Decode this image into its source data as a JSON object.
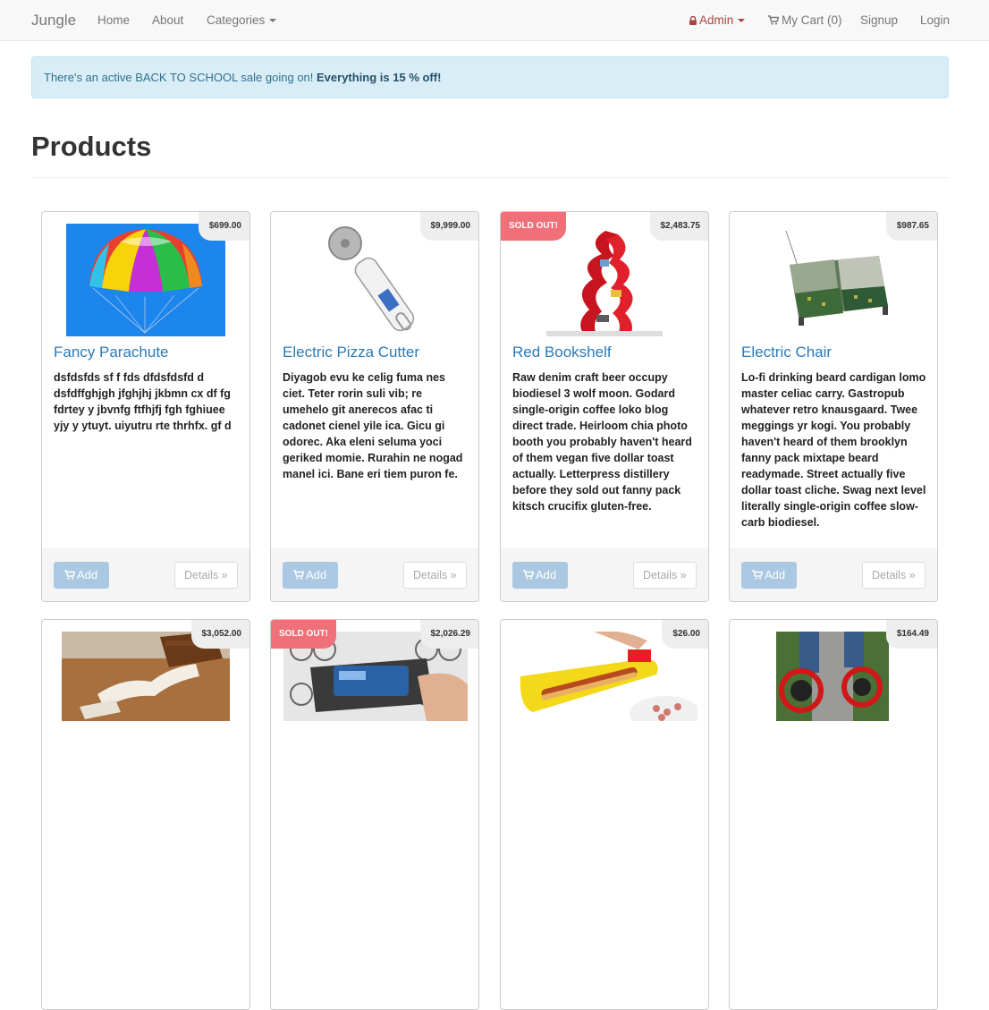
{
  "navbar": {
    "brand": "Jungle",
    "home": "Home",
    "about": "About",
    "categories": "Categories",
    "admin": "Admin",
    "cart": "My Cart (0)",
    "signup": "Signup",
    "login": "Login"
  },
  "alert": {
    "text": "There's an active BACK TO SCHOOL sale going on! ",
    "emphasis": "Everything is 15 % off!"
  },
  "page_title": "Products",
  "buttons": {
    "add": "Add",
    "details": "Details »"
  },
  "sold_out_label": "SOLD OUT!",
  "products": [
    {
      "name": "Fancy Parachute",
      "price": "$699.00",
      "sold_out": false,
      "description": "dsfdsfds sf f fds dfdsfdsfd d dsfdffghjgh jfghjhj jkbmn cx df fg fdrtey y jbvnfg ftfhjfj fgh fghiuee yjy y ytuyt. uiyutru rte thrhfx. gf d"
    },
    {
      "name": "Electric Pizza Cutter",
      "price": "$9,999.00",
      "sold_out": false,
      "description": "Diyagob evu ke celig fuma nes ciet. Teter rorin suli vib; re umehelo git anerecos afac ti cadonet cienel yile ica. Gicu gi odorec. Aka eleni seluma yoci geriked momie. Rurahin ne nogad manel ici. Bane eri tiem puron fe."
    },
    {
      "name": "Red Bookshelf",
      "price": "$2,483.75",
      "sold_out": true,
      "description": "Raw denim craft beer occupy biodiesel 3 wolf moon. Godard single-origin coffee loko blog direct trade. Heirloom chia photo booth you probably haven't heard of them vegan five dollar toast actually. Letterpress distillery before they sold out fanny pack kitsch crucifix gluten-free."
    },
    {
      "name": "Electric Chair",
      "price": "$987.65",
      "sold_out": false,
      "description": "Lo-fi drinking beard cardigan lomo master celiac carry. Gastropub whatever retro knausgaard. Twee meggings yr kogi. You probably haven't heard of them brooklyn fanny pack mixtape beard readymade. Street actually five dollar toast cliche. Swag next level literally single-origin coffee slow-carb biodiesel."
    },
    {
      "price": "$3,052.00",
      "sold_out": false
    },
    {
      "price": "$2,026.29",
      "sold_out": true
    },
    {
      "price": "$26.00",
      "sold_out": false
    },
    {
      "price": "$164.49",
      "sold_out": false
    }
  ],
  "colors": {
    "link": "#2a7ab8",
    "sold_out": "#f0707a",
    "alert_bg": "#d9edf7",
    "admin": "#a94442"
  }
}
